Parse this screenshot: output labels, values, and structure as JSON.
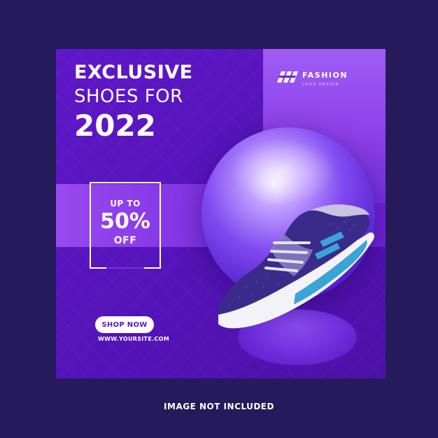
{
  "headline": {
    "line1": "EXCLUSIVE",
    "line2": "SHOES FOR",
    "line3": "2022"
  },
  "logo": {
    "icon": "fashion-logo-mark-icon",
    "name": "FASHION",
    "tagline": "LOGO DESIGN"
  },
  "offer": {
    "upto": "UP TO",
    "percent": "50%",
    "off": "OFF"
  },
  "cta": {
    "label": "SHOP NOW"
  },
  "website": "WWW.YOURSITE.COM",
  "footer_note": "IMAGE NOT INCLUDED",
  "colors": {
    "page_background": "#241a5c",
    "card_purple": "#5f17c9",
    "accent_light_purple": "#9a49f0",
    "shoe_accent_blue": "#3aa3d8",
    "white": "#ffffff"
  }
}
